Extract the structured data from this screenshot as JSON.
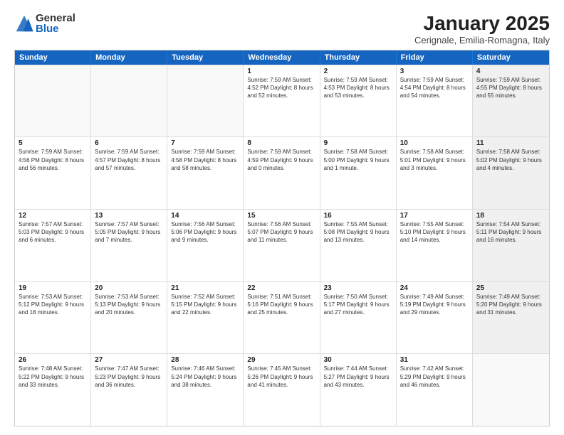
{
  "logo": {
    "general": "General",
    "blue": "Blue"
  },
  "title": "January 2025",
  "subtitle": "Cerignale, Emilia-Romagna, Italy",
  "header_days": [
    "Sunday",
    "Monday",
    "Tuesday",
    "Wednesday",
    "Thursday",
    "Friday",
    "Saturday"
  ],
  "weeks": [
    [
      {
        "day": "",
        "empty": true,
        "info": ""
      },
      {
        "day": "",
        "empty": true,
        "info": ""
      },
      {
        "day": "",
        "empty": true,
        "info": ""
      },
      {
        "day": "1",
        "info": "Sunrise: 7:59 AM\nSunset: 4:52 PM\nDaylight: 8 hours\nand 52 minutes."
      },
      {
        "day": "2",
        "info": "Sunrise: 7:59 AM\nSunset: 4:53 PM\nDaylight: 8 hours\nand 53 minutes."
      },
      {
        "day": "3",
        "info": "Sunrise: 7:59 AM\nSunset: 4:54 PM\nDaylight: 8 hours\nand 54 minutes."
      },
      {
        "day": "4",
        "shaded": true,
        "info": "Sunrise: 7:59 AM\nSunset: 4:55 PM\nDaylight: 8 hours\nand 55 minutes."
      }
    ],
    [
      {
        "day": "5",
        "info": "Sunrise: 7:59 AM\nSunset: 4:56 PM\nDaylight: 8 hours\nand 56 minutes."
      },
      {
        "day": "6",
        "info": "Sunrise: 7:59 AM\nSunset: 4:57 PM\nDaylight: 8 hours\nand 57 minutes."
      },
      {
        "day": "7",
        "info": "Sunrise: 7:59 AM\nSunset: 4:58 PM\nDaylight: 8 hours\nand 58 minutes."
      },
      {
        "day": "8",
        "info": "Sunrise: 7:59 AM\nSunset: 4:59 PM\nDaylight: 9 hours\nand 0 minutes."
      },
      {
        "day": "9",
        "info": "Sunrise: 7:58 AM\nSunset: 5:00 PM\nDaylight: 9 hours\nand 1 minute."
      },
      {
        "day": "10",
        "info": "Sunrise: 7:58 AM\nSunset: 5:01 PM\nDaylight: 9 hours\nand 3 minutes."
      },
      {
        "day": "11",
        "shaded": true,
        "info": "Sunrise: 7:58 AM\nSunset: 5:02 PM\nDaylight: 9 hours\nand 4 minutes."
      }
    ],
    [
      {
        "day": "12",
        "info": "Sunrise: 7:57 AM\nSunset: 5:03 PM\nDaylight: 9 hours\nand 6 minutes."
      },
      {
        "day": "13",
        "info": "Sunrise: 7:57 AM\nSunset: 5:05 PM\nDaylight: 9 hours\nand 7 minutes."
      },
      {
        "day": "14",
        "info": "Sunrise: 7:56 AM\nSunset: 5:06 PM\nDaylight: 9 hours\nand 9 minutes."
      },
      {
        "day": "15",
        "info": "Sunrise: 7:56 AM\nSunset: 5:07 PM\nDaylight: 9 hours\nand 11 minutes."
      },
      {
        "day": "16",
        "info": "Sunrise: 7:55 AM\nSunset: 5:08 PM\nDaylight: 9 hours\nand 13 minutes."
      },
      {
        "day": "17",
        "info": "Sunrise: 7:55 AM\nSunset: 5:10 PM\nDaylight: 9 hours\nand 14 minutes."
      },
      {
        "day": "18",
        "shaded": true,
        "info": "Sunrise: 7:54 AM\nSunset: 5:11 PM\nDaylight: 9 hours\nand 16 minutes."
      }
    ],
    [
      {
        "day": "19",
        "info": "Sunrise: 7:53 AM\nSunset: 5:12 PM\nDaylight: 9 hours\nand 18 minutes."
      },
      {
        "day": "20",
        "info": "Sunrise: 7:53 AM\nSunset: 5:13 PM\nDaylight: 9 hours\nand 20 minutes."
      },
      {
        "day": "21",
        "info": "Sunrise: 7:52 AM\nSunset: 5:15 PM\nDaylight: 9 hours\nand 22 minutes."
      },
      {
        "day": "22",
        "info": "Sunrise: 7:51 AM\nSunset: 5:16 PM\nDaylight: 9 hours\nand 25 minutes."
      },
      {
        "day": "23",
        "info": "Sunrise: 7:50 AM\nSunset: 5:17 PM\nDaylight: 9 hours\nand 27 minutes."
      },
      {
        "day": "24",
        "info": "Sunrise: 7:49 AM\nSunset: 5:19 PM\nDaylight: 9 hours\nand 29 minutes."
      },
      {
        "day": "25",
        "shaded": true,
        "info": "Sunrise: 7:49 AM\nSunset: 5:20 PM\nDaylight: 9 hours\nand 31 minutes."
      }
    ],
    [
      {
        "day": "26",
        "info": "Sunrise: 7:48 AM\nSunset: 5:22 PM\nDaylight: 9 hours\nand 33 minutes."
      },
      {
        "day": "27",
        "info": "Sunrise: 7:47 AM\nSunset: 5:23 PM\nDaylight: 9 hours\nand 36 minutes."
      },
      {
        "day": "28",
        "info": "Sunrise: 7:46 AM\nSunset: 5:24 PM\nDaylight: 9 hours\nand 38 minutes."
      },
      {
        "day": "29",
        "info": "Sunrise: 7:45 AM\nSunset: 5:26 PM\nDaylight: 9 hours\nand 41 minutes."
      },
      {
        "day": "30",
        "info": "Sunrise: 7:44 AM\nSunset: 5:27 PM\nDaylight: 9 hours\nand 43 minutes."
      },
      {
        "day": "31",
        "info": "Sunrise: 7:42 AM\nSunset: 5:29 PM\nDaylight: 9 hours\nand 46 minutes."
      },
      {
        "day": "",
        "empty": true,
        "shaded": true,
        "info": ""
      }
    ]
  ]
}
